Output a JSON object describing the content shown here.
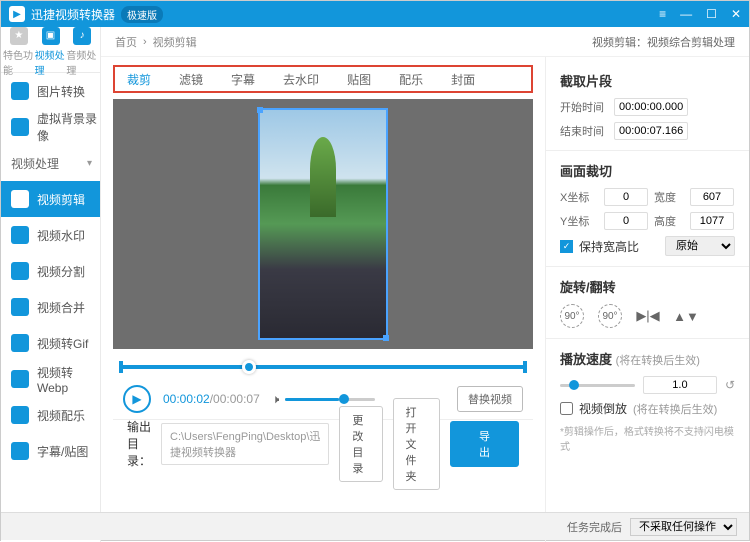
{
  "titlebar": {
    "title": "迅捷视频转换器",
    "badge": "极速版"
  },
  "sideTabs": [
    "特色功能",
    "视频处理",
    "音频处理"
  ],
  "nav": {
    "groupHead": "视频处理",
    "items": [
      "图片转换",
      "虚拟背景录像",
      "视频剪辑",
      "视频水印",
      "视频分割",
      "视频合并",
      "视频转Gif",
      "视频转Webp",
      "视频配乐",
      "字幕/贴图"
    ]
  },
  "crumb": {
    "home": "首页",
    "sep": "›",
    "page": "视频剪辑",
    "right": "视频剪辑：视频综合剪辑处理"
  },
  "etabs": [
    "裁剪",
    "滤镜",
    "字幕",
    "去水印",
    "贴图",
    "配乐",
    "封面"
  ],
  "player": {
    "cur": "00:00:02",
    "dur": "/00:00:07",
    "replace": "替换视频"
  },
  "panel": {
    "sec1": "截取片段",
    "startLbl": "开始时间",
    "start": "00:00:00.000",
    "endLbl": "结束时间",
    "end": "00:00:07.166",
    "sec2": "画面裁切",
    "xLbl": "X坐标",
    "x": "0",
    "wLbl": "宽度",
    "w": "607",
    "yLbl": "Y坐标",
    "y": "0",
    "hLbl": "高度",
    "h": "1077",
    "keepRatio": "保持宽高比",
    "ratioSel": "原始",
    "sec3": "旋转/翻转",
    "sec4": "播放速度",
    "sec4note": "(将在转换后生效)",
    "speed": "1.0",
    "reverse": "视频倒放",
    "reverseNote": "(将在转换后生效)",
    "tip": "*剪辑操作后，格式转换将不支持闪电模式"
  },
  "out": {
    "lbl": "输出目录：",
    "path": "C:\\Users\\FengPing\\Desktop\\迅捷视频转换器",
    "change": "更改目录",
    "open": "打开文件夹",
    "export": "导出"
  },
  "status": {
    "lbl": "任务完成后",
    "opt": "不采取任何操作"
  }
}
